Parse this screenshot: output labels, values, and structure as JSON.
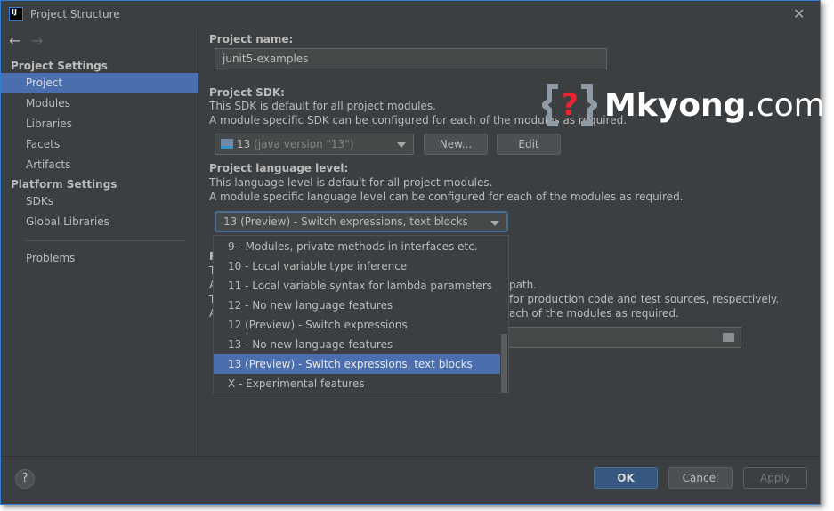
{
  "window": {
    "title": "Project Structure",
    "app_icon": "IJ",
    "close": "✕"
  },
  "sidebar": {
    "back": "←",
    "forward": "→",
    "project_settings": "Project Settings",
    "items": [
      {
        "label": "Project"
      },
      {
        "label": "Modules"
      },
      {
        "label": "Libraries"
      },
      {
        "label": "Facets"
      },
      {
        "label": "Artifacts"
      }
    ],
    "platform_settings": "Platform Settings",
    "platform_items": [
      {
        "label": "SDKs"
      },
      {
        "label": "Global Libraries"
      }
    ],
    "problems": "Problems"
  },
  "main": {
    "project_name_label": "Project name:",
    "project_name": "junit5-examples",
    "sdk_label": "Project SDK:",
    "sdk_desc1": "This SDK is default for all project modules.",
    "sdk_desc2": "A module specific SDK can be configured for each of the modules as required.",
    "sdk_value": "13",
    "sdk_value_detail": "(java version \"13\")",
    "new_button": "New...",
    "edit_button": "Edit",
    "lang_label": "Project language level:",
    "lang_desc1": "This language level is default for all project modules.",
    "lang_desc2": "A module specific language level can be configured for each of the modules as required.",
    "lang_value": "13 (Preview) - Switch expressions, text blocks",
    "hidden_fragments": [
      "P",
      "T",
      "A",
      "path.",
      "T",
      "for production code and test sources, respectively.",
      "A",
      "ach of the modules as required."
    ]
  },
  "dropdown": {
    "options": [
      "9 - Modules, private methods in interfaces etc.",
      "10 - Local variable type inference",
      "11 - Local variable syntax for lambda parameters",
      "12 - No new language features",
      "12 (Preview) - Switch expressions",
      "13 - No new language features",
      "13 (Preview) - Switch expressions, text blocks",
      "X - Experimental features"
    ],
    "selected": "13 (Preview) - Switch expressions, text blocks"
  },
  "watermark": {
    "brand": "Mkyong",
    "suffix": ".com"
  },
  "footer": {
    "help": "?",
    "ok": "OK",
    "cancel": "Cancel",
    "apply": "Apply"
  },
  "colors": {
    "selection": "#4b6eaf",
    "background": "#3c3f41",
    "ok_button": "#365880"
  }
}
